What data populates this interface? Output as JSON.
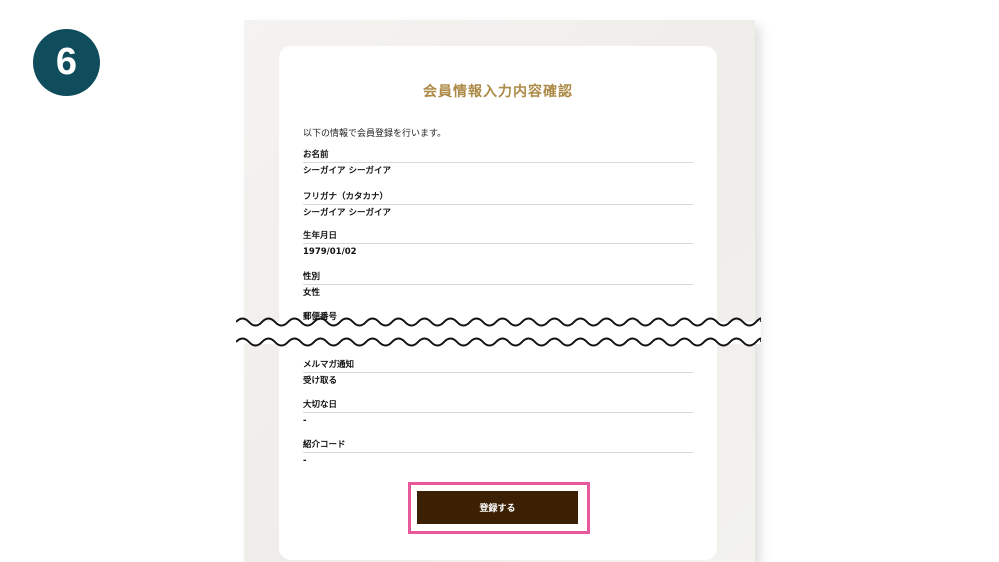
{
  "step_number": "6",
  "form": {
    "title": "会員情報入力内容確認",
    "intro": "以下の情報で会員登録を行います。",
    "fields": [
      {
        "label": "お名前",
        "value": "シーガイア シーガイア"
      },
      {
        "label": "フリガナ（カタカナ）",
        "value": "シーガイア シーガイア"
      },
      {
        "label": "生年月日",
        "value": "1979/01/02"
      },
      {
        "label": "性別",
        "value": "女性"
      },
      {
        "label": "郵便番号",
        "value": ""
      },
      {
        "label": "メルマガ通知",
        "value": "受け取る"
      },
      {
        "label": "大切な日",
        "value": "-"
      },
      {
        "label": "紹介コード",
        "value": "-"
      }
    ],
    "register_label": "登録する"
  },
  "colors": {
    "badge": "#0f4c5c",
    "title": "#ad8a47",
    "button": "#3b2003",
    "highlight": "#e8589a"
  }
}
